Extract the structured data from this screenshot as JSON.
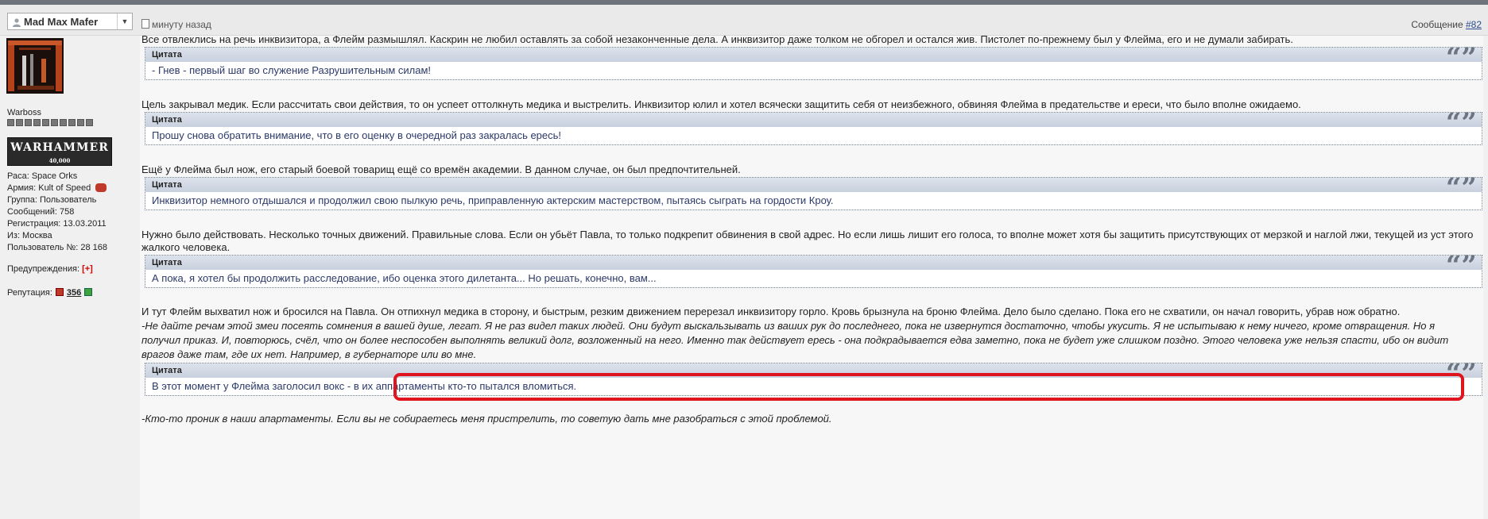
{
  "header": {
    "username": "Mad Max Mafer",
    "time": "минуту назад",
    "message_label": "Сообщение",
    "message_number": "#82"
  },
  "sidebar": {
    "rank": "Warboss",
    "logo_text": "WARHAMMER",
    "logo_sub": "40,000",
    "info": [
      "Раса: Space Orks",
      "Армия: Kult of Speed",
      "Группа: Пользователь",
      "Сообщений: 758",
      "Регистрация: 13.03.2011",
      "Из: Москва",
      "Пользователь №: 28 168"
    ],
    "warnings_label": "Предупреждения:",
    "warnings_value": "[+]",
    "reputation_label": "Репутация:",
    "reputation_value": "356"
  },
  "post": {
    "quote_label": "Цитата",
    "paragraphs": [
      "Все отвлеклись на речь инквизитора, а Флейм размышлял. Каскрин не любил оставлять за собой незаконченные дела. А инквизитор даже толком не обгорел и остался жив. Пистолет по-прежнему был у Флейма, его и не думали забирать.",
      "Цель закрывал медик. Если рассчитать свои действия, то он успеет оттолкнуть медика и выстрелить. Инквизитор юлил и хотел всячески защитить себя от неизбежного, обвиняя Флейма в предательстве и ереси, что было вполне ожидаемо.",
      "Ещё у Флейма был нож, его старый боевой товарищ ещё со времён академии. В данном случае, он был предпочтительней.",
      "Нужно было действовать. Несколько точных движений. Правильные слова. Если он убьёт Павла, то только подкрепит обвинения в свой адрес. Но если лишь лишит его голоса, то вполне может хотя бы защитить присутствующих от мерзкой и наглой лжи, текущей из уст этого",
      "жалкого человека.",
      "И тут Флейм выхватил нож и бросился на Павла. Он отпихнул медика в сторону, и быстрым, резким движением перерезал инквизитору горло. Кровь брызнула на броню Флейма. Дело было сделано. Пока его не схватили, он начал говорить, убрав нож обратно.",
      "-Не дайте речам этой змеи посеять сомнения в вашей душе, легат. Я не раз видел таких людей. Они будут выскальзывать из ваших рук до последнего, пока не извернутся достаточно, чтобы укусить. Я не испытываю к нему ничего, кроме отвращения. Но я",
      "получил приказ. И, повторюсь, счёл, что он более неспособен выполнять великий долг, возложенный на него. Именно так действует ересь - она подкрадывается едва заметно, пока не будет уже слишком поздно. Этого человека уже нельзя спасти, ибо он видит",
      "врагов даже там, где их нет. Например, в губернаторе или во мне.",
      "-Кто-то проник в наши апартаменты. Если вы не собираетесь меня пристрелить, то советую дать мне разобраться с этой проблемой."
    ],
    "quotes": [
      "- Гнев - первый шаг во служение Разрушительным силам!",
      "Прошу снова обратить внимание, что в его оценку в очередной раз закралась ересь!",
      "Инквизитор немного отдышался и продолжил свою пылкую речь, приправленную актерским мастерством, пытаясь сыграть на гордости Кроу.",
      "А пока, я хотел бы продолжить расследование, ибо оценка этого дилетанта... Но решать, конечно, вам...",
      "В этот момент у Флейма заголосил вокс - в их аппартаменты кто-то пытался вломиться."
    ]
  }
}
